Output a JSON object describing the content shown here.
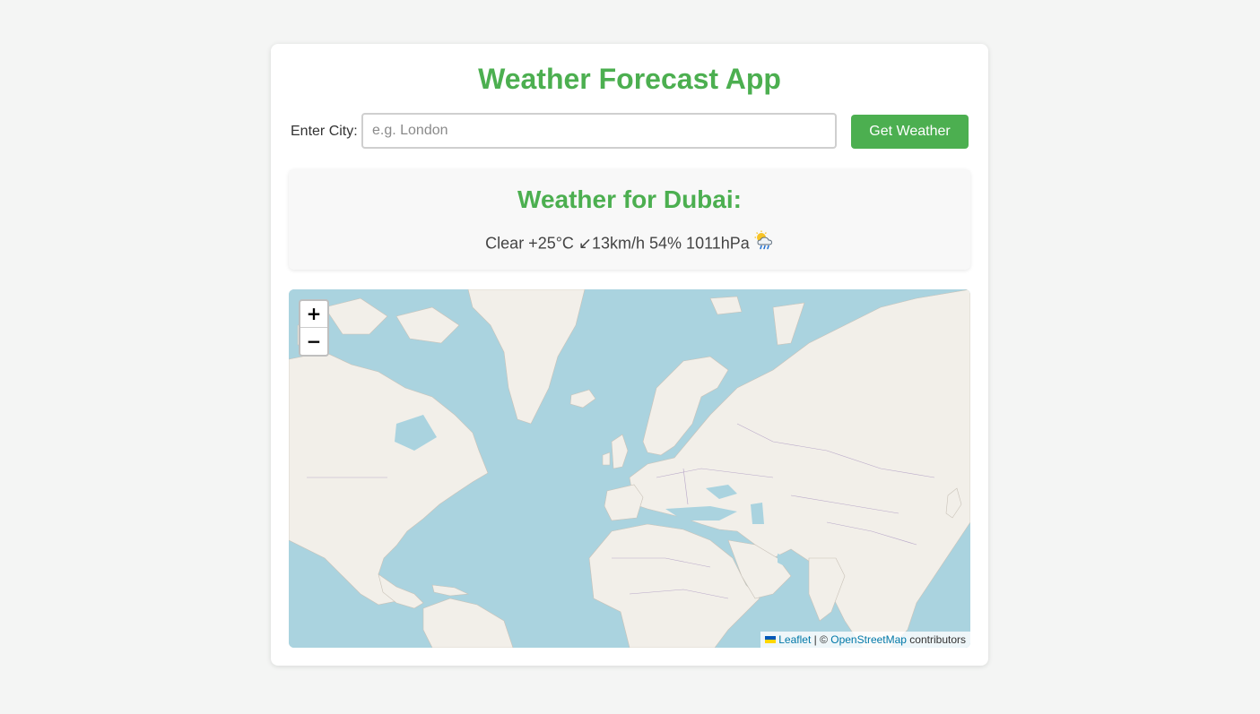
{
  "app": {
    "title": "Weather Forecast App"
  },
  "search": {
    "label": "Enter City:",
    "value": "",
    "placeholder": "e.g. London",
    "button_label": "Get Weather"
  },
  "result": {
    "heading": "Weather for Dubai:",
    "summary": "Clear +25°C ↙13km/h 54% 1011hPa",
    "icon": "sun-behind-rain-cloud-icon"
  },
  "map": {
    "zoom_in_label": "+",
    "zoom_out_label": "−",
    "attribution": {
      "leaflet_label": "Leaflet",
      "separator": " | © ",
      "osm_label": "OpenStreetMap",
      "suffix": " contributors"
    },
    "colors": {
      "water": "#aad3df",
      "land": "#f2efe9",
      "border": "#b9a9c9"
    }
  },
  "colors": {
    "accent": "#4caf50",
    "background": "#f4f5f4",
    "card": "#ffffff"
  }
}
